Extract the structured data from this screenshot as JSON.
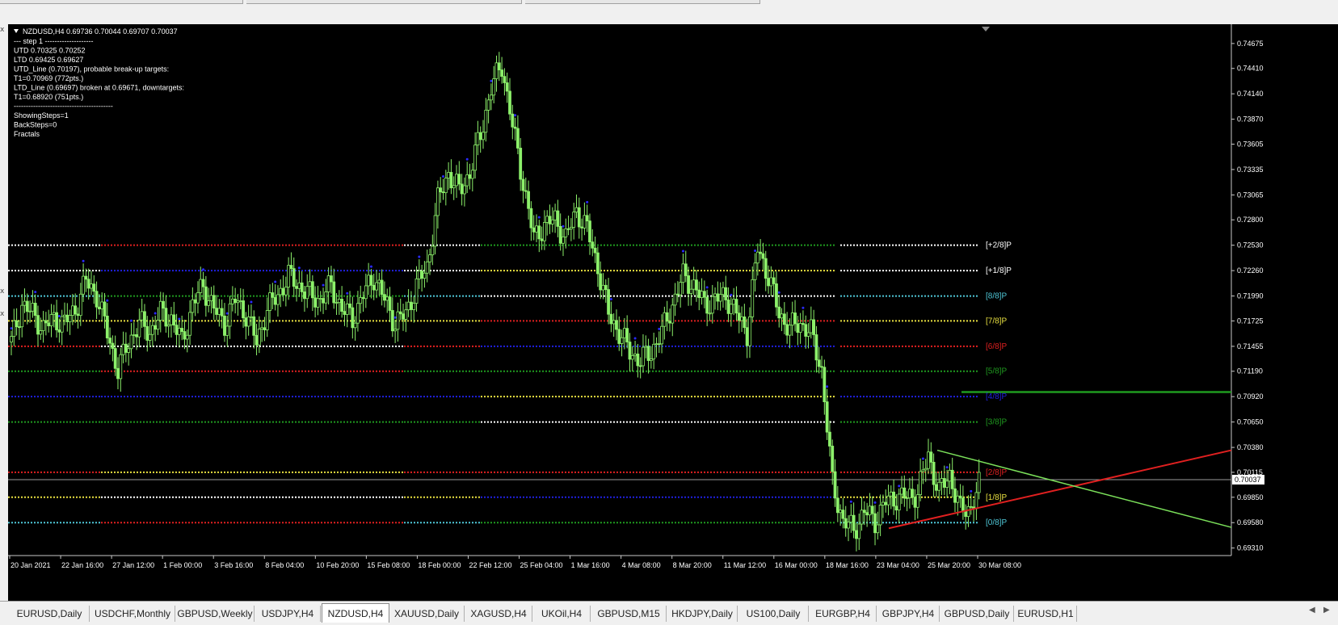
{
  "window": {
    "active_tab": "NZDUSD,H4"
  },
  "tabs": [
    "EURUSD,Daily",
    "USDCHF,Monthly",
    "GBPUSD,Weekly",
    "USDJPY,H4",
    "NZDUSD,H4",
    "XAUUSD,Daily",
    "XAGUSD,H4",
    "UKOil,H4",
    "GBPUSD,M15",
    "HKDJPY,Daily",
    "US100,Daily",
    "EURGBP,H4",
    "GBPJPY,H4",
    "GBPUSD,Daily",
    "EURUSD,H1"
  ],
  "tab_arrows": {
    "left": "◀",
    "right": "▶"
  },
  "left_marks": [
    "x",
    "x",
    "x"
  ],
  "chart_data": {
    "type": "candlestick",
    "symbol_header": "NZDUSD,H4  0.69736 0.70044 0.69707 0.70037",
    "info_lines": [
      "---   step 1   --------------------",
      "UTD 0.70325  0.70252",
      "LTD  0.69425  0.69627",
      "UTD_Line (0.70197), probable break-up targets:",
      "T1=0.70969 (772pts.)",
      "LTD_Line (0.69697) broken at 0.69671, downtargets:",
      "T1=0.68920 (751pts.)",
      "-----------------------------------------",
      "ShowingSteps=1",
      "BackSteps=0",
      "Fractals"
    ],
    "y_ticks": [
      "0.74675",
      "0.74410",
      "0.74140",
      "0.73870",
      "0.73605",
      "0.73335",
      "0.73065",
      "0.72800",
      "0.72530",
      "0.72260",
      "0.71990",
      "0.71725",
      "0.71455",
      "0.71190",
      "0.70920",
      "0.70650",
      "0.70380",
      "0.70115",
      "0.69850",
      "0.69580",
      "0.69310"
    ],
    "y_tick_values": [
      0.74675,
      0.7441,
      0.7414,
      0.7387,
      0.73605,
      0.73335,
      0.73065,
      0.728,
      0.7253,
      0.7226,
      0.7199,
      0.71725,
      0.71455,
      0.7119,
      0.7092,
      0.7065,
      0.7038,
      0.70115,
      0.6985,
      0.6958,
      0.6931
    ],
    "ylim": [
      0.6923,
      0.7488
    ],
    "current_price": "0.70037",
    "current_price_value": 0.70037,
    "x_ticks": [
      "20 Jan 2021",
      "22 Jan 16:00",
      "27 Jan 12:00",
      "1 Feb 00:00",
      "3 Feb 16:00",
      "8 Feb 04:00",
      "10 Feb 20:00",
      "15 Feb 08:00",
      "18 Feb 00:00",
      "22 Feb 12:00",
      "25 Feb 04:00",
      "1 Mar 16:00",
      "4 Mar 08:00",
      "8 Mar 20:00",
      "11 Mar 12:00",
      "16 Mar 00:00",
      "18 Mar 16:00",
      "23 Mar 04:00",
      "25 Mar 20:00",
      "30 Mar 08:00"
    ],
    "murrey_labels": [
      {
        "text": "[+2/8]P",
        "value": 0.7253,
        "color": "#ffffff"
      },
      {
        "text": "[+1/8]P",
        "value": 0.7226,
        "color": "#ffffff"
      },
      {
        "text": "[8/8]P",
        "value": 0.7199,
        "color": "#4fc8d8"
      },
      {
        "text": "[7/8]P",
        "value": 0.71725,
        "color": "#e8e040"
      },
      {
        "text": "[6/8]P",
        "value": 0.71455,
        "color": "#e02020"
      },
      {
        "text": "[5/8]P",
        "value": 0.7119,
        "color": "#1f9a1f"
      },
      {
        "text": "[4/8]P",
        "value": 0.7092,
        "color": "#2020e0"
      },
      {
        "text": "[3/8]P",
        "value": 0.7065,
        "color": "#1f9a1f"
      },
      {
        "text": "[2/8]P",
        "value": 0.70115,
        "color": "#e02020"
      },
      {
        "text": "[1/8]P",
        "value": 0.6985,
        "color": "#e8e040"
      },
      {
        "text": "[0/8]P",
        "value": 0.6958,
        "color": "#4fc8d8"
      }
    ],
    "series": [
      {
        "name": "close",
        "values": [
          0.715,
          0.719,
          0.718,
          0.7165,
          0.7175,
          0.717,
          0.7185,
          0.7215,
          0.72,
          0.716,
          0.712,
          0.715,
          0.717,
          0.716,
          0.718,
          0.7175,
          0.715,
          0.719,
          0.721,
          0.7185,
          0.717,
          0.7195,
          0.718,
          0.715,
          0.7185,
          0.72,
          0.722,
          0.721,
          0.72,
          0.7195,
          0.721,
          0.7185,
          0.7175,
          0.72,
          0.722,
          0.7195,
          0.717,
          0.718,
          0.721,
          0.723,
          0.73,
          0.733,
          0.731,
          0.733,
          0.737,
          0.742,
          0.7445,
          0.738,
          0.732,
          0.726,
          0.7275,
          0.728,
          0.726,
          0.729,
          0.727,
          0.723,
          0.718,
          0.716,
          0.714,
          0.713,
          0.714,
          0.716,
          0.719,
          0.722,
          0.721,
          0.719,
          0.7195,
          0.72,
          0.718,
          0.716,
          0.725,
          0.722,
          0.718,
          0.7165,
          0.717,
          0.716,
          0.712,
          0.7,
          0.696,
          0.695,
          0.697,
          0.696,
          0.698,
          0.6985,
          0.6985,
          0.699,
          0.703,
          0.699,
          0.701,
          0.697,
          0.6975,
          0.7004
        ]
      }
    ],
    "overlay_lines": [
      {
        "name": "LTD_Line",
        "color": "#e02020"
      },
      {
        "name": "UTD_Line",
        "color": "#7be05a"
      },
      {
        "name": "T1 target",
        "color": "#1f9a1f",
        "value": 0.70969
      }
    ]
  }
}
